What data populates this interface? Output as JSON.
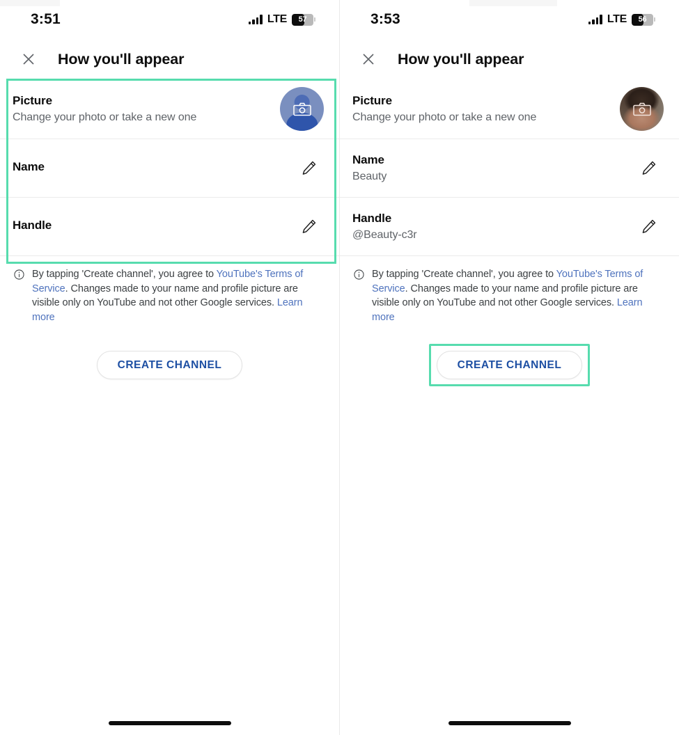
{
  "screens": [
    {
      "id": "before",
      "status": {
        "time": "3:51",
        "network": "LTE",
        "battery": "57",
        "battery_pct": 57,
        "signal_icon": "signal-bars-icon",
        "battery_icon": "battery-icon"
      },
      "appbar": {
        "close_icon": "close-icon",
        "title": "How you'll appear"
      },
      "rows": [
        {
          "label": "Picture",
          "value": "Change your photo or take a new one",
          "accessory": "avatar",
          "avatar_type": "placeholder",
          "avatar_icon": "camera-icon"
        },
        {
          "label": "Name",
          "value": "",
          "accessory": "edit",
          "edit_icon": "pencil-icon"
        },
        {
          "label": "Handle",
          "value": "",
          "accessory": "edit",
          "edit_icon": "pencil-icon"
        }
      ],
      "terms": {
        "info_icon": "info-icon",
        "part1": "By tapping 'Create channel', you agree to ",
        "link1": "YouTube's Terms of Service",
        "part2": ". Changes made to your name and profile picture are visible only on YouTube and not other Google services. ",
        "link2": "Learn more"
      },
      "cta": {
        "label": "CREATE CHANNEL",
        "highlighted": false
      },
      "card_highlighted": true
    },
    {
      "id": "after",
      "status": {
        "time": "3:53",
        "network": "LTE",
        "battery": "56",
        "battery_pct": 56,
        "signal_icon": "signal-bars-icon",
        "battery_icon": "battery-icon"
      },
      "appbar": {
        "close_icon": "close-icon",
        "title": "How you'll appear"
      },
      "rows": [
        {
          "label": "Picture",
          "value": "Change your photo or take a new one",
          "accessory": "avatar",
          "avatar_type": "photo",
          "avatar_icon": "camera-icon"
        },
        {
          "label": "Name",
          "value": "Beauty",
          "accessory": "edit",
          "edit_icon": "pencil-icon"
        },
        {
          "label": "Handle",
          "value": "@Beauty-c3r",
          "accessory": "edit",
          "edit_icon": "pencil-icon"
        }
      ],
      "terms": {
        "info_icon": "info-icon",
        "part1": "By tapping 'Create channel', you agree to ",
        "link1": "YouTube's Terms of Service",
        "part2": ". Changes made to your name and profile picture are visible only on YouTube and not other Google services. ",
        "link2": "Learn more"
      },
      "cta": {
        "label": "CREATE CHANNEL",
        "highlighted": true
      },
      "card_highlighted": false
    }
  ],
  "colors": {
    "highlight": "#57dcae",
    "link": "#4f73bd",
    "cta_text": "#1d4fa3",
    "label": "#0d0d0d",
    "secondary_text": "#5f6368"
  }
}
